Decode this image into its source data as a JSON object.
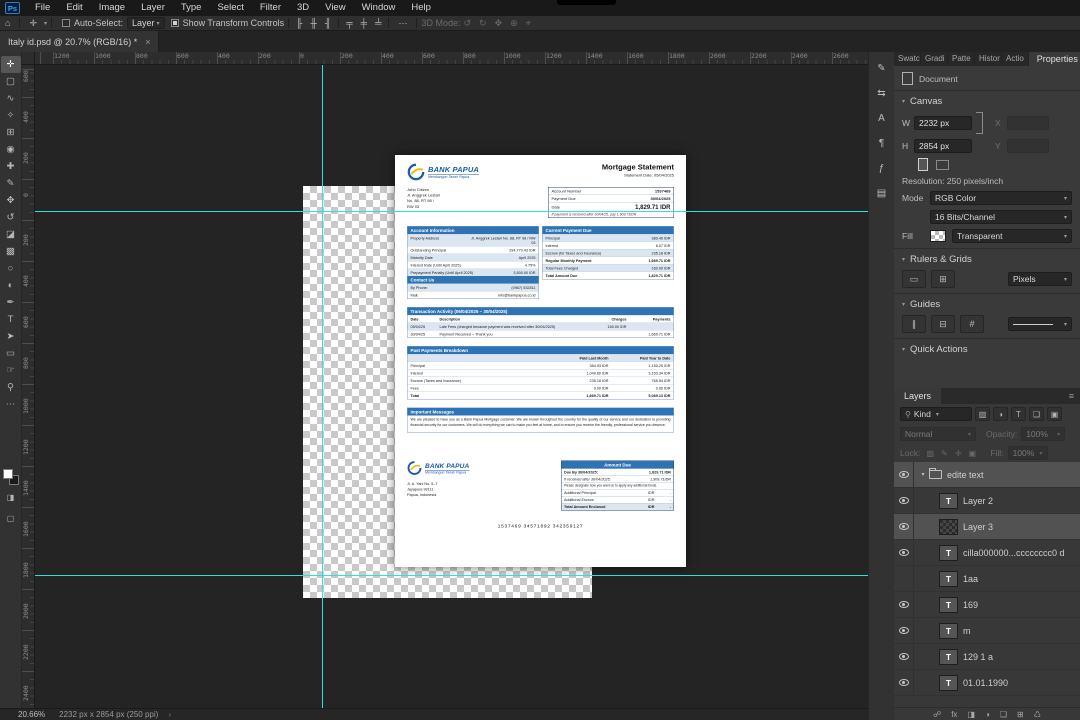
{
  "menubar": {
    "app_icon": "Ps",
    "items": [
      "File",
      "Edit",
      "Image",
      "Layer",
      "Type",
      "Select",
      "Filter",
      "3D",
      "View",
      "Window",
      "Help"
    ]
  },
  "options_bar": {
    "home_icon": "⌂",
    "tool_icon": "✛",
    "caret": "▾",
    "auto_select_label": "Auto-Select:",
    "auto_select_value": "Layer",
    "show_transform_label": "Show Transform Controls",
    "more_icon": "⋯",
    "mode_label": "3D Mode:",
    "align_icons": [
      {
        "name": "align-left-icon",
        "glyph": "╟"
      },
      {
        "name": "align-center-icon",
        "glyph": "╫"
      },
      {
        "name": "align-right-icon",
        "glyph": "╢"
      }
    ],
    "distribute_icons": [
      {
        "name": "align-top-icon",
        "glyph": "╤"
      },
      {
        "name": "align-middle-icon",
        "glyph": "╪"
      },
      {
        "name": "align-bottom-icon",
        "glyph": "╧"
      }
    ],
    "mode_icons": [
      {
        "name": "orbit-3d-icon",
        "glyph": "↺"
      },
      {
        "name": "roll-3d-icon",
        "glyph": "↻"
      },
      {
        "name": "drag-3d-icon",
        "glyph": "✥"
      },
      {
        "name": "slide-3d-icon",
        "glyph": "⊕"
      },
      {
        "name": "scale-3d-icon",
        "gl yph": "",
        "glyph": "⌖"
      }
    ]
  },
  "document_tab": {
    "title": "Italy id.psd @ 20.7% (RGB/16) *",
    "close": "×"
  },
  "tools": [
    {
      "name": "move-tool",
      "glyph": "✛",
      "_class": "selected"
    },
    {
      "name": "marquee-tool",
      "glyph": "▢"
    },
    {
      "name": "lasso-tool",
      "glyph": "∿"
    },
    {
      "name": "quick-selection-tool",
      "glyph": "✧"
    },
    {
      "name": "crop-tool",
      "glyph": "⊞"
    },
    {
      "name": "eyedropper-tool",
      "glyph": "◉"
    },
    {
      "name": "healing-brush-tool",
      "glyph": "✚"
    },
    {
      "name": "brush-tool",
      "glyph": "✎"
    },
    {
      "name": "clone-stamp-tool",
      "glyph": "✥"
    },
    {
      "name": "history-brush-tool",
      "glyph": "↺"
    },
    {
      "name": "eraser-tool",
      "glyph": "◪"
    },
    {
      "name": "gradient-tool",
      "glyph": "▩"
    },
    {
      "name": "blur-tool",
      "glyph": "○"
    },
    {
      "name": "dodge-tool",
      "glyph": "◐"
    },
    {
      "name": "pen-tool",
      "glyph": "✒"
    },
    {
      "name": "type-tool",
      "glyph": "T"
    },
    {
      "name": "path-select-tool",
      "glyph": "➤"
    },
    {
      "name": "shape-tool",
      "glyph": "▭"
    },
    {
      "name": "hand-tool",
      "glyph": "☞"
    },
    {
      "name": "zoom-tool",
      "glyph": "⚲"
    },
    {
      "name": "edit-toolbar-icon",
      "glyph": "⋯"
    }
  ],
  "rulers": {
    "horizontal": [
      "1200",
      "1000",
      "800",
      "600",
      "400",
      "200",
      "0",
      "200",
      "400",
      "600",
      "800",
      "1000",
      "1200",
      "1400",
      "1600",
      "1800",
      "2000",
      "2200",
      "2400",
      "2600"
    ],
    "vertical": [
      "600",
      "400",
      "200",
      "0",
      "200",
      "400",
      "600",
      "800",
      "1000",
      "1200",
      "1400",
      "1600",
      "1800",
      "2000",
      "2200",
      "2400"
    ]
  },
  "right_rail_icons": [
    {
      "name": "brushes-panel-icon",
      "glyph": "✎"
    },
    {
      "name": "tool-presets-panel-icon",
      "glyph": "⇆"
    },
    {
      "name": "character-panel-icon",
      "glyph": "A"
    },
    {
      "name": "paragraph-panel-icon",
      "glyph": "¶"
    },
    {
      "name": "glyphs-panel-icon",
      "glyph": "ƒ"
    },
    {
      "name": "libraries-panel-icon",
      "glyph": "▤"
    }
  ],
  "panel_tabs": [
    "Swatc",
    "Gradi",
    "Patte",
    "Histor",
    "Actio"
  ],
  "properties": {
    "tab": "Properties",
    "menu_icon": "≡",
    "caret": "▾",
    "document_label": "Document",
    "canvas_section": "Canvas",
    "w_label": "W",
    "w_value": "2232 px",
    "x_label": "X",
    "h_label": "H",
    "h_value": "2854 px",
    "y_label": "Y",
    "resolution": "Resolution: 250 pixels/inch",
    "mode_label": "Mode",
    "mode_value": "RGB Color",
    "bits_value": "16 Bits/Channel",
    "fill_label": "Fill",
    "fill_value": "Transparent",
    "rulers_section": "Rulers & Grids",
    "ruler_icons": [
      {
        "name": "ruler-icon",
        "glyph": "▭"
      },
      {
        "name": "grid-icon",
        "glyph": "⊞"
      }
    ],
    "units_value": "Pixels",
    "guides_section": "Guides",
    "guide_icons": [
      {
        "name": "new-guide-layout-icon",
        "glyph": "∥"
      },
      {
        "name": "guides-visibility-icon",
        "glyph": "⊟"
      },
      {
        "name": "clear-guides-icon",
        "glyph": "#"
      }
    ],
    "quick_actions_section": "Quick Actions"
  },
  "layers_panel": {
    "tab": "Layers",
    "menu_icon": "≡",
    "search_icon": "⚲",
    "caret": "▾",
    "filter_label": "Kind",
    "filter_icons": [
      {
        "name": "pixel-filter-icon",
        "glyph": "▨"
      },
      {
        "name": "adjustment-filter-icon",
        "glyph": "◑"
      },
      {
        "name": "type-filter-icon",
        "glyph": "T"
      },
      {
        "name": "shape-filter-icon",
        "glyph": "❏"
      },
      {
        "name": "smart-object-filter-icon",
        "glyph": "▣"
      }
    ],
    "blend_mode": "Normal",
    "opacity_label": "Opacity:",
    "opacity_value": "100%",
    "lock_label": "Lock:",
    "lock_icons": [
      {
        "name": "lock-transparent-icon",
        "glyph": "▨"
      },
      {
        "name": "lock-pixels-icon",
        "glyph": "✎"
      },
      {
        "name": "lock-position-icon",
        "glyph": "✛"
      },
      {
        "name": "lock-all-icon",
        "glyph": "▣"
      }
    ],
    "fill_label": "Fill:",
    "fill_value": "100%",
    "items": [
      {
        "name": "edite text",
        "_class": "group selected"
      },
      {
        "name": "Layer 2",
        "thumb": "T",
        "_class": "child"
      },
      {
        "name": "Layer 3",
        "_class": "child image selected"
      },
      {
        "name": "cilla000000...cccccccc0 d",
        "thumb": "T",
        "_class": "child"
      },
      {
        "name": "1aa",
        "thumb": "T",
        "_class": "child hidden"
      },
      {
        "name": "169",
        "thumb": "T",
        "_class": "child"
      },
      {
        "name": "m",
        "thumb": "T",
        "_class": "child"
      },
      {
        "name": "129 1 a",
        "thumb": "T",
        "_class": "child"
      },
      {
        "name": "01.01.1990",
        "thumb": "T",
        "_class": "child"
      }
    ],
    "bottom_icons": [
      {
        "name": "link-layers-icon",
        "glyph": "☍"
      },
      {
        "name": "layer-effects-icon",
        "glyph": "fx"
      },
      {
        "name": "layer-mask-icon",
        "glyph": "◨"
      },
      {
        "name": "adjustment-layer-icon",
        "glyph": "◑"
      },
      {
        "name": "new-group-icon",
        "glyph": "❏"
      },
      {
        "name": "new-layer-icon",
        "glyph": "⊞"
      },
      {
        "name": "delete-layer-icon",
        "glyph": "♺"
      }
    ]
  },
  "status_bar": {
    "zoom": "20.66%",
    "dimensions": "2232 px x 2854 px (250 ppi)",
    "arrow": "›"
  },
  "page": {
    "brand": {
      "name": "BANK PAPUA",
      "tagline": "Membangun Tanah Papua"
    },
    "title": "Mortgage Statement",
    "statement_date": "Statement Date: 05/04/2025",
    "recipient": [
      "John Citizen",
      "Jl. Anggrek Lestari",
      "No. 88, RT 98 /",
      "RW 03"
    ],
    "summary": {
      "rows_simple": [
        {
          "label": "Account Number",
          "value": "1537469"
        },
        {
          "label": "Payment Due",
          "value": "30/04/2025"
        }
      ],
      "amount_label": "Date",
      "amount_value": "1,829.71 IDR",
      "note": "If payment is received after 30/04/25, pay 1,909.71IDR"
    },
    "account_info": {
      "title": "Account Information",
      "rows": [
        {
          "label": "Property Address",
          "value": "Jl. Anggrek Lestari No. 88, RT 98 / RW 03"
        },
        {
          "label": "Outstanding Principal",
          "value": "294,770.43 IDR"
        },
        {
          "label": "Maturity Date",
          "value": "April 2025"
        },
        {
          "label": "Interest Rate (Until April 2025)",
          "value": "4.75%"
        },
        {
          "label": "Prepayment Penalty (Until April 2025)",
          "value": "3,500.00 IDR"
        }
      ]
    },
    "contact": {
      "title": "Contact Us",
      "rows": [
        {
          "label": "By Phone:",
          "value": "(0967) 532811"
        },
        {
          "label": "Mail:",
          "value": "info@bankpapua.co.id"
        }
      ]
    },
    "current_payment": {
      "title": "Current Payment Due",
      "rows": [
        {
          "label": "Principal",
          "value": "380.46 IDR"
        },
        {
          "label": "Interest",
          "value": "8.07 IDR"
        },
        {
          "label": "Escrow (for Taxes and Insurance)",
          "value": "235.18 IDR"
        },
        {
          "label": "Regular Monthly Payment",
          "value": "1,669.71 IDR",
          "_class": "bold"
        },
        {
          "label": "Total Fees Charged",
          "value": "160.00 IDR"
        },
        {
          "label": "Total Amount Due",
          "value": "1,829.71 IDR",
          "_class": "bold"
        }
      ]
    },
    "transactions": {
      "title": "Transaction Activity (05/04/2025 – 30/04/2025)",
      "headers": [
        "Date",
        "Description",
        "Charges",
        "Payments"
      ],
      "rows": [
        {
          "date": "05/04/25",
          "desc": "Late Fees (charged because payment was received after 30/04/2025)",
          "charge": "160.00 IDR",
          "payment": ""
        },
        {
          "date": "30/04/25",
          "desc": "Payment Received – Thank you",
          "charge": "",
          "payment": "1,669.71 IDR"
        }
      ]
    },
    "past_payments": {
      "title": "Past Payments Breakdown",
      "col_last": "Paid Last Month",
      "col_ytd": "Paid Year to Date",
      "rows": [
        {
          "label": "Principal",
          "last": "384.93 IDR",
          "ytd": "1,150.25 IDR"
        },
        {
          "label": "Interest",
          "last": "1,049.60 IDR",
          "ytd": "3,153.34 IDR"
        },
        {
          "label": "Escrow (Taxes and Insurance)",
          "last": "235.18 IDR",
          "ytd": "765.54 IDR"
        },
        {
          "label": "Fees",
          "last": "0.00 IDR",
          "ytd": "0.00 IDR"
        },
        {
          "label": "Total",
          "last": "1,669.71 IDR",
          "ytd": "5,069.13 IDR",
          "_class": "bold"
        }
      ]
    },
    "messages": {
      "title": "Important Messages",
      "body": "We are pleased to have you as a Bank Papua Mortgage customer. We are known throughout the country for the quality of our service and our dedication to providing financial security for our customers. We will do everything we can to make you feel at home, and to ensure you receive the friendly, professional service you deserve."
    },
    "footer_address": [
      "Jl. A. Yani No. 5–7",
      "Jayapura 99111",
      "Papua, Indonesia"
    ],
    "amount_due": {
      "title": "Amount Due",
      "due_label": "Due By 30/04/2025:",
      "due_value": "1,829.71 IDR",
      "late_label": "If received after 30/04/2025:",
      "late_value": "1,909.71IDR",
      "note": "Please designate how you want us to apply any additional funds.",
      "rows": [
        {
          "label": "Additional Principal",
          "cur": "IDR",
          "value": "-"
        },
        {
          "label": "Additional Escrow",
          "cur": "IDR",
          "value": "-"
        },
        {
          "label": "Total Amount Enclosed",
          "cur": "IDR",
          "value": "-",
          "_class": "bold total"
        }
      ]
    },
    "barcode_number": "1537469 34571892 342359127"
  }
}
